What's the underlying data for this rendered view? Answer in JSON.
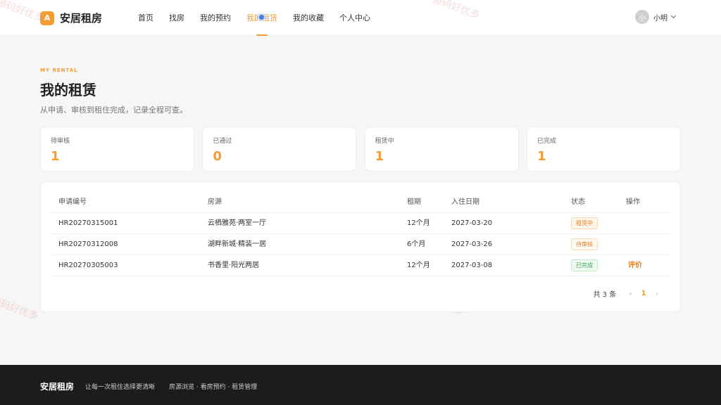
{
  "brand": {
    "badge": "A",
    "name": "安居租房"
  },
  "nav": [
    {
      "label": "首页",
      "active": false
    },
    {
      "label": "找房",
      "active": false
    },
    {
      "label": "我的预约",
      "active": false
    },
    {
      "label": "我的租赁",
      "active": true
    },
    {
      "label": "我的收藏",
      "active": false
    },
    {
      "label": "个人中心",
      "active": false
    }
  ],
  "user": {
    "avatar_text": "小",
    "name": "小明"
  },
  "watermark": "源码好优多",
  "heading": {
    "eyebrow": "MY RENTAL",
    "title": "我的租赁",
    "subtitle": "从申请、审核到租住完成，记录全程可查。"
  },
  "stats": [
    {
      "label": "待审核",
      "value": "1"
    },
    {
      "label": "已通过",
      "value": "0"
    },
    {
      "label": "租赁中",
      "value": "1"
    },
    {
      "label": "已完成",
      "value": "1"
    }
  ],
  "table": {
    "headers": [
      "申请编号",
      "房源",
      "租期",
      "入住日期",
      "状态",
      "操作"
    ],
    "rows": [
      {
        "id": "HR20270315001",
        "house": "云栖雅苑·两室一厅",
        "term": "12个月",
        "date": "2027-03-20",
        "status": "租赁中",
        "action": ""
      },
      {
        "id": "HR20270312008",
        "house": "湖畔新城·精装一居",
        "term": "6个月",
        "date": "2027-03-26",
        "status": "待审核",
        "action": ""
      },
      {
        "id": "HR20270305003",
        "house": "书香里·阳光两居",
        "term": "12个月",
        "date": "2027-03-08",
        "status": "已完成",
        "action": "评价"
      }
    ]
  },
  "pagination": {
    "total_text": "共 3 条",
    "prev": "‹",
    "current": "1",
    "next": "›"
  },
  "footer": {
    "brand": "安居租房",
    "slogan": "让每一次租住选择更清晰",
    "links": "房源浏览 · 看房预约 · 租赁管理"
  }
}
